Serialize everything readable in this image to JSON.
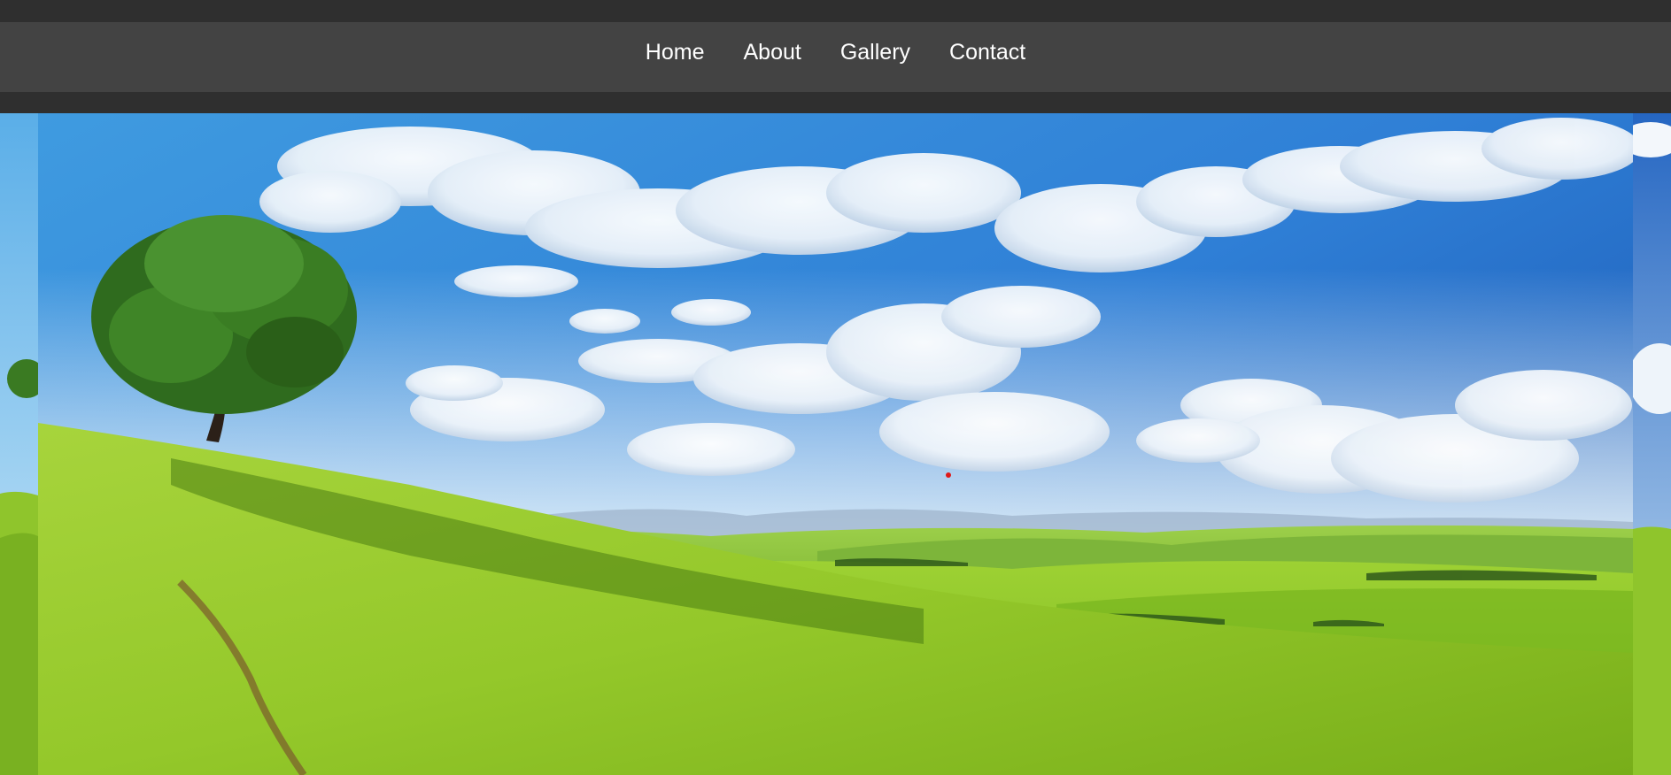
{
  "nav": {
    "items": [
      {
        "label": "Home"
      },
      {
        "label": "About"
      },
      {
        "label": "Gallery"
      },
      {
        "label": "Contact"
      }
    ]
  },
  "carousel": {
    "slide_scene": "landscape with lone tree on green hill under blue sky with clouds",
    "colors": {
      "sky_top": "#1f5fb8",
      "sky_bottom": "#bfe3f7",
      "grass_light": "#a5d43a",
      "grass_dark": "#4f8a12",
      "tree_foliage": "#2f6b1e",
      "cursor_dot": "#e01818"
    }
  }
}
